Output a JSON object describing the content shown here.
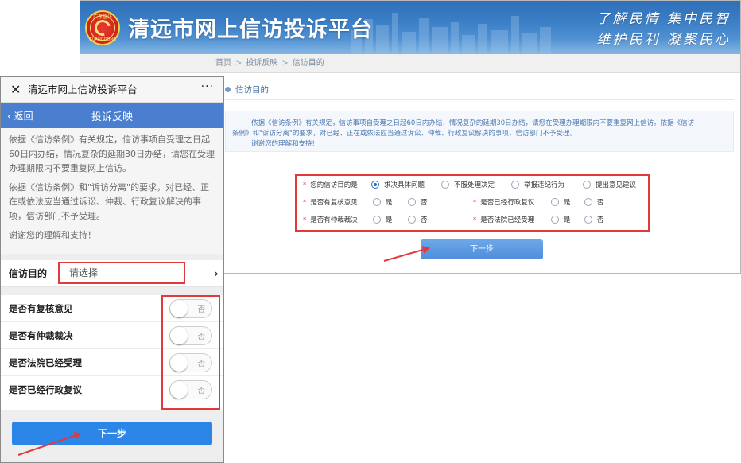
{
  "desktop": {
    "emblem_top": "广东信访",
    "emblem_bottom": "GUANGDONG",
    "site_title": "清远市网上信访投诉平台",
    "slogan_line1": "了解民情 集中民智",
    "slogan_line2": "维护民利 凝聚民心",
    "breadcrumb": [
      "首页",
      "投诉反映",
      "信访目的"
    ],
    "breadcrumb_sep": ">",
    "section_title": "信访目的",
    "notice_lines": [
      "依据《信访条例》有关规定，信访事项自受理之日起60日内办结，情况复杂的延期30日办结，请您在受理办理期限内不要重复网上信访。依据《信访",
      "条例》和\"诉访分离\"的要求，对已经、正在或依法应当通过诉讼、仲裁、行政复议解决的事项，信访部门不予受理。",
      "谢谢您的理解和支持!"
    ],
    "form": {
      "purpose_label": "您的信访目的是",
      "purpose_options": [
        "求决具体问题",
        "不服处理决定",
        "举报违纪行为",
        "提出意见建议"
      ],
      "purpose_selected": 0,
      "q_review": "是否有复核意见",
      "q_admin_review": "是否已经行政复议",
      "q_arbitration": "是否有仲裁裁决",
      "q_court": "是否法院已经受理",
      "yes": "是",
      "no": "否",
      "required_mark": "*"
    },
    "next_label": "下一步"
  },
  "mobile": {
    "close_glyph": "✕",
    "title": "清远市网上信访投诉平台",
    "more_glyph": "···",
    "back_label": "‹ 返回",
    "bar_title": "投诉反映",
    "notice": [
      "依据《信访条例》有关规定，信访事项自受理之日起60日内办结，情况复杂的延期30日办结，请您在受理办理期限内不要重复网上信访。",
      "依据《信访条例》和\"诉访分离\"的要求，对已经、正在或依法应当通过诉讼、仲裁、行政复议解决的事项，信访部门不予受理。",
      "谢谢您的理解和支持！"
    ],
    "purpose_label": "信访目的",
    "purpose_placeholder": "请选择",
    "chevron_glyph": "›",
    "toggles": [
      {
        "label": "是否有复核意见",
        "state": "否"
      },
      {
        "label": "是否有仲裁裁决",
        "state": "否"
      },
      {
        "label": "是否法院已经受理",
        "state": "否"
      },
      {
        "label": "是否已经行政复议",
        "state": "否"
      }
    ],
    "next_label": "下一步"
  },
  "colors": {
    "banner_blue": "#3b7fc6",
    "annotation_red": "#e2393c",
    "mobile_bar": "#4a7fcf",
    "mobile_next": "#2c86e8"
  }
}
